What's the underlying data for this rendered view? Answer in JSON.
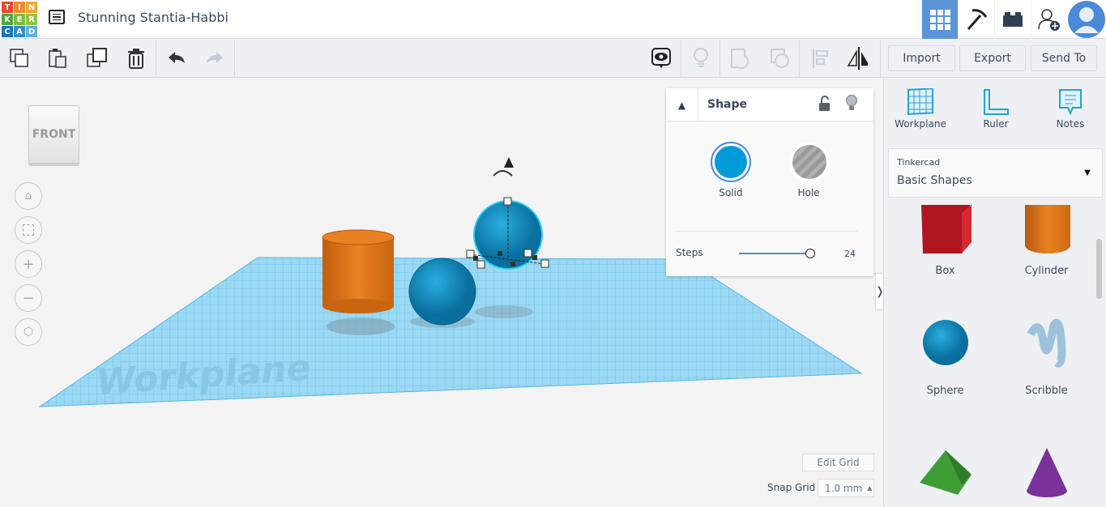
{
  "app": {
    "logo_letters": [
      "T",
      "I",
      "N",
      "K",
      "E",
      "R",
      "C",
      "A",
      "D"
    ],
    "logo_colors": [
      "#e8472b",
      "#f28b2c",
      "#f6a32b",
      "#4aa83d",
      "#7cbf3a",
      "#8fc63f",
      "#1c74bb",
      "#2d8fd1",
      "#5cb0e4"
    ],
    "design_title": "Stunning Stantia-Habbi"
  },
  "topbar_icons": [
    "3d-view-icon",
    "pickaxe-icon",
    "brick-icon",
    "add-user-icon",
    "avatar-icon"
  ],
  "toolbar": {
    "import_label": "Import",
    "export_label": "Export",
    "send_to_label": "Send To"
  },
  "viewcube": {
    "face_label": "FRONT"
  },
  "workplane": {
    "watermark": "Workplane"
  },
  "inspector": {
    "title": "Shape",
    "solid_label": "Solid",
    "hole_label": "Hole",
    "solid_color": "#009bd8",
    "steps_label": "Steps",
    "steps_value": "24",
    "steps_fraction": 1.0
  },
  "grid": {
    "edit_grid_label": "Edit Grid",
    "snap_grid_label": "Snap Grid",
    "snap_grid_value": "1.0 mm"
  },
  "right_panel": {
    "tools": [
      {
        "label": "Workplane"
      },
      {
        "label": "Ruler"
      },
      {
        "label": "Notes"
      }
    ],
    "library_source": "Tinkercad",
    "library_name": "Basic Shapes",
    "shapes": [
      {
        "label": "Box"
      },
      {
        "label": "Cylinder"
      },
      {
        "label": "Sphere"
      },
      {
        "label": "Scribble"
      }
    ]
  }
}
